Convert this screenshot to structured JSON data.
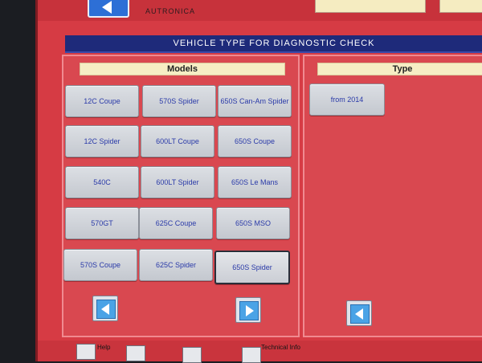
{
  "header": {
    "brand": "AUTRONICA"
  },
  "title": "VEHICLE TYPE FOR DIAGNOSTIC CHECK",
  "models_panel": {
    "heading": "Models",
    "buttons": [
      "12C Coupe",
      "570S Spider",
      "650S Can-Am Spider",
      "12C Spider",
      "600LT Coupe",
      "650S Coupe",
      "540C",
      "600LT Spider",
      "650S Le Mans",
      "570GT",
      "625C Coupe",
      "650S MSO",
      "570S Coupe",
      "625C Spider",
      "650S Spider"
    ],
    "selected": "650S Spider"
  },
  "type_panel": {
    "heading": "Type",
    "buttons": [
      "from 2014"
    ]
  },
  "footer": {
    "help_label": "Help",
    "technical_info_label": "Technical Info"
  },
  "icons": {
    "prev": "left-arrow-icon",
    "next": "right-arrow-icon",
    "type_prev": "left-arrow-icon"
  }
}
